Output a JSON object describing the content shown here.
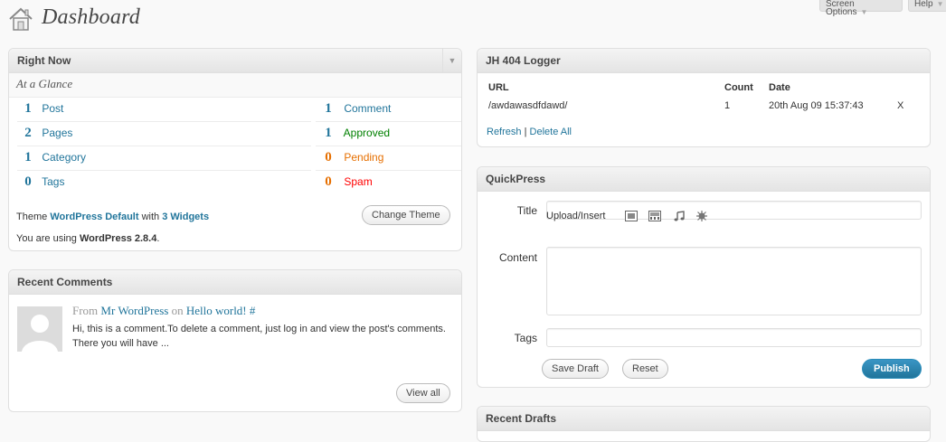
{
  "header": {
    "title": "Dashboard",
    "screen_options_label": "Screen Options",
    "help_label": "Help"
  },
  "right_now": {
    "title": "Right Now",
    "subtitle": "At a Glance",
    "content_rows": [
      {
        "count": "1",
        "label": "Post"
      },
      {
        "count": "2",
        "label": "Pages"
      },
      {
        "count": "1",
        "label": "Category"
      },
      {
        "count": "0",
        "label": "Tags"
      }
    ],
    "discussion_rows": [
      {
        "count": "1",
        "label": "Comment"
      },
      {
        "count": "1",
        "label": "Approved"
      },
      {
        "count": "0",
        "label": "Pending"
      },
      {
        "count": "0",
        "label": "Spam"
      }
    ],
    "theme_prefix": "Theme",
    "theme_name": "WordPress Default",
    "theme_with": "with",
    "widgets_link": "3 Widgets",
    "change_theme_label": "Change Theme",
    "version_prefix": "You are using",
    "version_name": "WordPress 2.8.4",
    "version_suffix": "."
  },
  "recent_comments": {
    "title": "Recent Comments",
    "from_label": "From",
    "author": "Mr WordPress",
    "on_label": "on",
    "post_link": "Hello world!",
    "hash_link": "#",
    "excerpt": "Hi, this is a comment.To delete a comment, just log in and view the post's comments. There you will have ...",
    "view_all_label": "View all"
  },
  "logger": {
    "title": "JH 404 Logger",
    "columns": [
      "URL",
      "Count",
      "Date"
    ],
    "rows": [
      {
        "url": "/awdawasdfdawd/",
        "count": "1",
        "date": "20th Aug 09 15:37:43",
        "delete": "X"
      }
    ],
    "refresh_label": "Refresh",
    "separator": "|",
    "delete_all_label": "Delete All"
  },
  "quickpress": {
    "title": "QuickPress",
    "title_label": "Title",
    "title_value": "",
    "upload_label": "Upload/Insert",
    "content_label": "Content",
    "content_value": "",
    "tags_label": "Tags",
    "tags_value": "",
    "save_draft_label": "Save Draft",
    "reset_label": "Reset",
    "publish_label": "Publish"
  },
  "recent_drafts": {
    "title": "Recent Drafts"
  },
  "colors": {
    "link": "#21759b",
    "approved": "#008000",
    "pending": "#e66f00",
    "spam": "#ff0000",
    "publish": "#21759b"
  }
}
